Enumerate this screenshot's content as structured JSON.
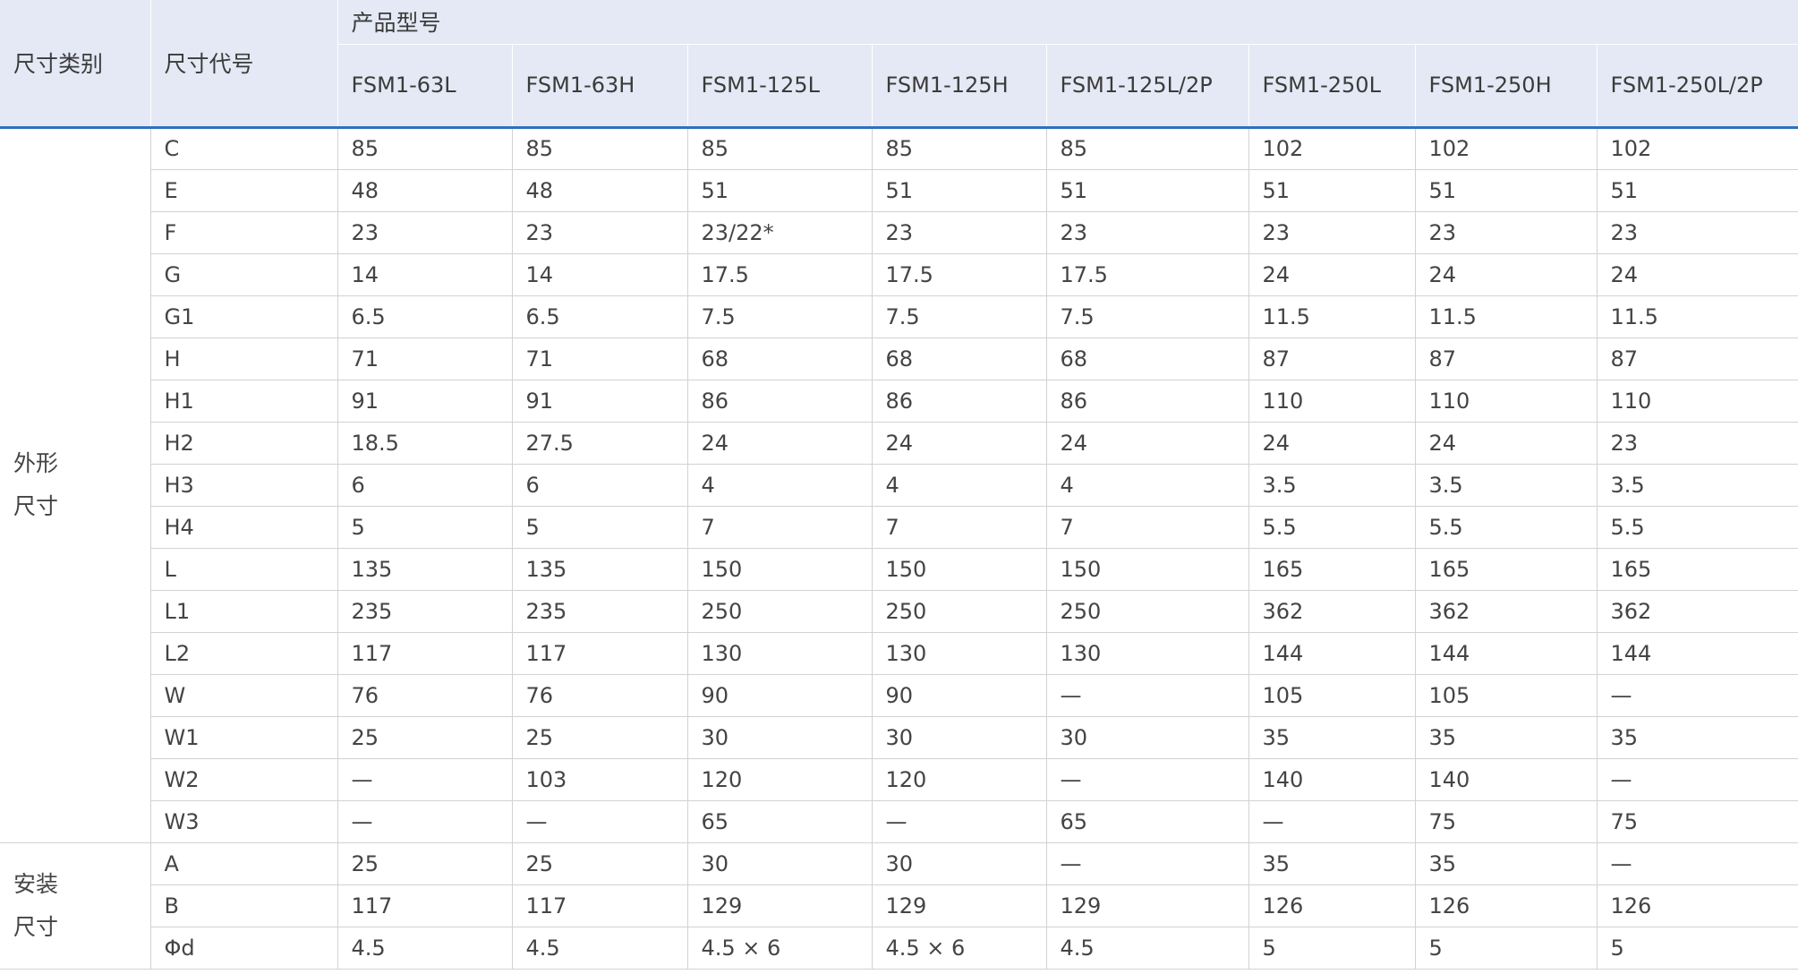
{
  "header": {
    "category_label": "尺寸类别",
    "code_label": "尺寸代号",
    "group_label": "产品型号",
    "models": [
      "FSM1-63L",
      "FSM1-63H",
      "FSM1-125L",
      "FSM1-125H",
      "FSM1-125L/2P",
      "FSM1-250L",
      "FSM1-250H",
      "FSM1-250L/2P"
    ]
  },
  "groups": [
    {
      "label_line1": "外形",
      "label_line2": "尺寸",
      "rows": [
        {
          "code": "C",
          "values": [
            "85",
            "85",
            "85",
            "85",
            "85",
            "102",
            "102",
            "102"
          ]
        },
        {
          "code": "E",
          "values": [
            "48",
            "48",
            "51",
            "51",
            "51",
            "51",
            "51",
            "51"
          ]
        },
        {
          "code": "F",
          "values": [
            "23",
            "23",
            "23/22*",
            "23",
            "23",
            "23",
            "23",
            "23"
          ]
        },
        {
          "code": "G",
          "values": [
            "14",
            "14",
            "17.5",
            "17.5",
            "17.5",
            "24",
            "24",
            "24"
          ]
        },
        {
          "code": "G1",
          "values": [
            "6.5",
            "6.5",
            "7.5",
            "7.5",
            "7.5",
            "11.5",
            "11.5",
            "11.5"
          ]
        },
        {
          "code": "H",
          "values": [
            "71",
            "71",
            "68",
            "68",
            "68",
            "87",
            "87",
            "87"
          ]
        },
        {
          "code": "H1",
          "values": [
            "91",
            "91",
            "86",
            "86",
            "86",
            "110",
            "110",
            "110"
          ]
        },
        {
          "code": "H2",
          "values": [
            "18.5",
            "27.5",
            "24",
            "24",
            "24",
            "24",
            "24",
            "23"
          ]
        },
        {
          "code": "H3",
          "values": [
            "6",
            "6",
            "4",
            "4",
            "4",
            "3.5",
            "3.5",
            "3.5"
          ]
        },
        {
          "code": "H4",
          "values": [
            "5",
            "5",
            "7",
            "7",
            "7",
            "5.5",
            "5.5",
            "5.5"
          ]
        },
        {
          "code": "L",
          "values": [
            "135",
            "135",
            "150",
            "150",
            "150",
            "165",
            "165",
            "165"
          ]
        },
        {
          "code": "L1",
          "values": [
            "235",
            "235",
            "250",
            "250",
            "250",
            "362",
            "362",
            "362"
          ]
        },
        {
          "code": "L2",
          "values": [
            "117",
            "117",
            "130",
            "130",
            "130",
            "144",
            "144",
            "144"
          ]
        },
        {
          "code": "W",
          "values": [
            "76",
            "76",
            "90",
            "90",
            "—",
            "105",
            "105",
            "—"
          ]
        },
        {
          "code": "W1",
          "values": [
            "25",
            "25",
            "30",
            "30",
            "30",
            "35",
            "35",
            "35"
          ]
        },
        {
          "code": "W2",
          "values": [
            "—",
            "103",
            "120",
            "120",
            "—",
            "140",
            "140",
            "—"
          ]
        },
        {
          "code": "W3",
          "values": [
            "—",
            "—",
            "65",
            "—",
            "65",
            "—",
            "75",
            "75"
          ]
        }
      ]
    },
    {
      "label_line1": "安装",
      "label_line2": "尺寸",
      "rows": [
        {
          "code": "A",
          "values": [
            "25",
            "25",
            "30",
            "30",
            "—",
            "35",
            "35",
            "—"
          ]
        },
        {
          "code": "B",
          "values": [
            "117",
            "117",
            "129",
            "129",
            "129",
            "126",
            "126",
            "126"
          ]
        },
        {
          "code": "Φd",
          "values": [
            "4.5",
            "4.5",
            "4.5 × 6",
            "4.5 × 6",
            "4.5",
            "5",
            "5",
            "5"
          ]
        }
      ]
    }
  ]
}
